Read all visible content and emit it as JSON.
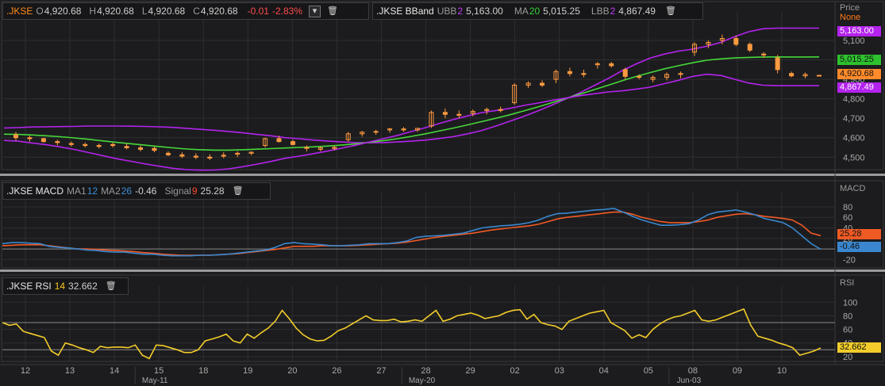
{
  "price_header": {
    "symbol": ".JKSE",
    "o_label": "O",
    "o_value": "4,920.68",
    "h_label": "H",
    "h_value": "4,920.68",
    "l_label": "L",
    "l_value": "4,920.68",
    "c_label": "C",
    "c_value": "4,920.68",
    "change": "-0.01",
    "change_pct": "-2.83%"
  },
  "bband_header": {
    "ticker": ".JKSE BBand",
    "ubb_label": "UBB",
    "ubb_param": "2",
    "ubb_value": "5,163.00",
    "ma_label": "MA",
    "ma_param": "20",
    "ma_value": "5,015.25",
    "lbb_label": "LBB",
    "lbb_param": "2",
    "lbb_value": "4,867.49"
  },
  "macd_header": {
    "ticker": ".JKSE MACD",
    "ma1_label": "MA1",
    "ma1_param": "12",
    "ma2_label": "MA2",
    "ma2_param": "26",
    "ma2_value": "-0.46",
    "signal_label": "Signal",
    "signal_param": "9",
    "signal_value": "25.28"
  },
  "rsi_header": {
    "ticker": ".JKSE RSI",
    "param": "14",
    "value": "32.662"
  },
  "axis_titles": {
    "price": "Price",
    "price_sub": "None",
    "macd": "MACD",
    "rsi": "RSI"
  },
  "tags": {
    "ubb": "5,163.00",
    "ma": "5,015.25",
    "close": "4,920.68",
    "lbb": "4,867.49",
    "signal": "25.28",
    "macd": "-0.46",
    "rsi": "32.662"
  },
  "colors": {
    "background": "#1c1c1e",
    "candle": "#ff9a40",
    "upper_band": "#b423ee",
    "middle_band": "#46d83a",
    "lower_band": "#b423ee",
    "macd_line": "#3a87cf",
    "signal_line": "#f05a24",
    "rsi_line": "#f2cc2a",
    "grid": "#2e2e30",
    "axis_text": "#a8a8a8"
  },
  "chart_data": [
    {
      "type": "candlestick",
      "panel": "price",
      "x_labels": [
        "12",
        "13",
        "14",
        "15",
        "18",
        "19",
        "20",
        "26",
        "27",
        "28",
        "29",
        "02",
        "03",
        "04",
        "05",
        "08",
        "09",
        "10"
      ],
      "month_labels": [
        {
          "at": "15",
          "label": "May-11"
        },
        {
          "at": "28",
          "label": "May-20"
        },
        {
          "at": "08",
          "label": "Jun-03"
        }
      ],
      "y_ticks": [
        4500,
        4600,
        4700,
        4800,
        4900,
        5000,
        5100
      ],
      "ylim": [
        4440,
        5210
      ],
      "candles": [
        [
          4615,
          4630,
          4585,
          4600
        ],
        [
          4600,
          4610,
          4580,
          4595
        ],
        [
          4595,
          4600,
          4575,
          4580
        ],
        [
          4580,
          4590,
          4560,
          4575
        ],
        [
          4570,
          4580,
          4555,
          4565
        ],
        [
          4565,
          4575,
          4550,
          4560
        ],
        [
          4560,
          4570,
          4545,
          4555
        ],
        [
          4565,
          4575,
          4550,
          4560
        ],
        [
          4555,
          4570,
          4540,
          4548
        ],
        [
          4548,
          4560,
          4530,
          4540
        ],
        [
          4545,
          4555,
          4525,
          4535
        ],
        [
          4520,
          4530,
          4505,
          4512
        ],
        [
          4512,
          4525,
          4495,
          4505
        ],
        [
          4505,
          4520,
          4490,
          4500
        ],
        [
          4500,
          4515,
          4485,
          4495
        ],
        [
          4510,
          4525,
          4495,
          4505
        ],
        [
          4515,
          4530,
          4500,
          4520
        ],
        [
          4520,
          4530,
          4510,
          4525
        ],
        [
          4560,
          4600,
          4550,
          4595
        ],
        [
          4595,
          4610,
          4575,
          4580
        ],
        [
          4580,
          4590,
          4560,
          4565
        ],
        [
          4550,
          4560,
          4530,
          4545
        ],
        [
          4540,
          4555,
          4530,
          4548
        ],
        [
          4545,
          4560,
          4535,
          4550
        ],
        [
          4590,
          4630,
          4580,
          4620
        ],
        [
          4620,
          4635,
          4605,
          4628
        ],
        [
          4628,
          4640,
          4615,
          4632
        ],
        [
          4640,
          4650,
          4625,
          4645
        ],
        [
          4645,
          4655,
          4630,
          4640
        ],
        [
          4640,
          4650,
          4630,
          4648
        ],
        [
          4660,
          4740,
          4650,
          4730
        ],
        [
          4730,
          4750,
          4700,
          4720
        ],
        [
          4720,
          4740,
          4700,
          4715
        ],
        [
          4725,
          4745,
          4710,
          4735
        ],
        [
          4740,
          4755,
          4720,
          4745
        ],
        [
          4745,
          4760,
          4730,
          4740
        ],
        [
          4780,
          4880,
          4770,
          4870
        ],
        [
          4870,
          4890,
          4855,
          4880
        ],
        [
          4880,
          4895,
          4860,
          4870
        ],
        [
          4900,
          4950,
          4880,
          4940
        ],
        [
          4940,
          4960,
          4915,
          4930
        ],
        [
          4930,
          4950,
          4910,
          4925
        ],
        [
          4975,
          4990,
          4955,
          4980
        ],
        [
          4980,
          4990,
          4960,
          4970
        ],
        [
          4950,
          4960,
          4900,
          4915
        ],
        [
          4915,
          4925,
          4900,
          4910
        ],
        [
          4900,
          4920,
          4885,
          4910
        ],
        [
          4910,
          4935,
          4895,
          4925
        ],
        [
          4925,
          4940,
          4905,
          4930
        ],
        [
          5040,
          5090,
          5020,
          5080
        ],
        [
          5080,
          5100,
          5060,
          5090
        ],
        [
          5100,
          5130,
          5080,
          5110
        ],
        [
          5110,
          5125,
          5070,
          5080
        ],
        [
          5080,
          5090,
          5040,
          5050
        ],
        [
          5030,
          5040,
          5010,
          5025
        ],
        [
          5010,
          5025,
          4930,
          4950
        ],
        [
          4930,
          4940,
          4910,
          4918
        ],
        [
          4918,
          4935,
          4905,
          4925
        ],
        [
          4920.68,
          4920.68,
          4920.68,
          4920.68
        ]
      ],
      "bollinger": {
        "upper": [
          4650,
          4652,
          4655,
          4656,
          4657,
          4658,
          4660,
          4660,
          4660,
          4659,
          4658,
          4656,
          4653,
          4648,
          4643,
          4638,
          4632,
          4625,
          4617,
          4610,
          4600,
          4595,
          4588,
          4583,
          4578,
          4575,
          4574,
          4575,
          4578,
          4582,
          4588,
          4596,
          4606,
          4620,
          4637,
          4660,
          4685,
          4710,
          4738,
          4768,
          4800,
          4832,
          4868,
          4905,
          4945,
          4980,
          5010,
          5030,
          5045,
          5055,
          5070,
          5090,
          5120,
          5145,
          5160,
          5163,
          5163,
          5163,
          5163
        ],
        "middle": [
          4618,
          4617,
          4614,
          4610,
          4605,
          4599,
          4592,
          4584,
          4576,
          4569,
          4562,
          4555,
          4548,
          4542,
          4538,
          4536,
          4536,
          4538,
          4541,
          4544,
          4547,
          4550,
          4553,
          4557,
          4562,
          4568,
          4576,
          4585,
          4595,
          4607,
          4620,
          4635,
          4650,
          4666,
          4683,
          4700,
          4718,
          4738,
          4758,
          4780,
          4802,
          4824,
          4847,
          4870,
          4893,
          4915,
          4935,
          4954,
          4970,
          4985,
          4998,
          5005,
          5010,
          5013,
          5015,
          5015.25,
          5015,
          5015,
          5015.25
        ],
        "lower": [
          4586,
          4582,
          4573,
          4564,
          4553,
          4540,
          4524,
          4508,
          4492,
          4479,
          4466,
          4454,
          4443,
          4436,
          4433,
          4434,
          4440,
          4451,
          4464,
          4478,
          4494,
          4505,
          4518,
          4531,
          4546,
          4561,
          4578,
          4595,
          4612,
          4632,
          4652,
          4674,
          4694,
          4712,
          4729,
          4740,
          4751,
          4766,
          4778,
          4792,
          4804,
          4816,
          4826,
          4835,
          4841,
          4850,
          4860,
          4878,
          4895,
          4915,
          4926,
          4920,
          4900,
          4881,
          4870,
          4867.49,
          4867.49,
          4867.49,
          4867.49
        ]
      }
    },
    {
      "type": "line",
      "panel": "macd",
      "y_ticks": [
        -20,
        0,
        20,
        40,
        60,
        80
      ],
      "ylim": [
        -30,
        95
      ],
      "series": [
        {
          "name": "MACD",
          "values": [
            10,
            12,
            12,
            11,
            10,
            5,
            3,
            2,
            0,
            -2,
            -3,
            -5,
            -6,
            -6,
            -8,
            -10,
            -10,
            -12,
            -13,
            -13,
            -13,
            -12,
            -12,
            -11,
            -10,
            -8,
            -6,
            -4,
            -2,
            3,
            10,
            12,
            10,
            9,
            8,
            6,
            6,
            7,
            8,
            10,
            10,
            10,
            12,
            15,
            22,
            24,
            25,
            26,
            28,
            30,
            35,
            40,
            42,
            44,
            45,
            47,
            50,
            55,
            62,
            67,
            68,
            70,
            72,
            74,
            75,
            77,
            70,
            62,
            55,
            50,
            45,
            45,
            46,
            48,
            55,
            65,
            70,
            72,
            74,
            70,
            65,
            58,
            54,
            50,
            40,
            25,
            10,
            -0.46
          ]
        },
        {
          "name": "Signal",
          "values": [
            6,
            7,
            8,
            8,
            8,
            6,
            4,
            2,
            0,
            0,
            -1,
            -2,
            -3,
            -4,
            -5,
            -7,
            -8,
            -10,
            -11,
            -12,
            -12,
            -12,
            -12,
            -11,
            -10,
            -9,
            -7,
            -5,
            -3,
            -1,
            2,
            5,
            5,
            5,
            6,
            6,
            6,
            6,
            7,
            8,
            9,
            10,
            11,
            13,
            16,
            19,
            22,
            24,
            26,
            28,
            30,
            33,
            36,
            38,
            40,
            42,
            44,
            47,
            52,
            57,
            60,
            62,
            64,
            66,
            68,
            70,
            70,
            66,
            60,
            56,
            52,
            50,
            50,
            50,
            52,
            55,
            60,
            63,
            66,
            67,
            65,
            62,
            60,
            58,
            55,
            45,
            30,
            25.28
          ]
        }
      ]
    },
    {
      "type": "line",
      "panel": "rsi",
      "y_ticks": [
        20,
        40,
        60,
        80,
        100
      ],
      "ylim": [
        14,
        112
      ],
      "reference_lines": [
        30,
        70
      ],
      "series": [
        {
          "name": "RSI",
          "values": [
            70,
            66,
            68,
            57,
            54,
            51,
            48,
            28,
            22,
            40,
            37,
            33,
            30,
            26,
            35,
            33,
            34,
            34,
            33,
            37,
            22,
            17,
            37,
            36,
            33,
            30,
            26,
            26,
            30,
            43,
            46,
            49,
            53,
            43,
            40,
            53,
            47,
            55,
            62,
            72,
            88,
            76,
            62,
            52,
            46,
            43,
            44,
            50,
            58,
            62,
            68,
            74,
            80,
            74,
            73,
            73,
            75,
            71,
            72,
            74,
            72,
            80,
            88,
            72,
            75,
            80,
            82,
            84,
            81,
            76,
            78,
            80,
            85,
            88,
            89,
            75,
            82,
            70,
            67,
            65,
            60,
            72,
            76,
            80,
            84,
            86,
            88,
            70,
            64,
            58,
            47,
            52,
            48,
            60,
            68,
            74,
            78,
            80,
            84,
            88,
            74,
            72,
            74,
            78,
            82,
            86,
            90,
            66,
            50,
            47,
            44,
            40,
            37,
            33,
            22,
            25,
            28,
            32.662
          ]
        }
      ]
    }
  ]
}
